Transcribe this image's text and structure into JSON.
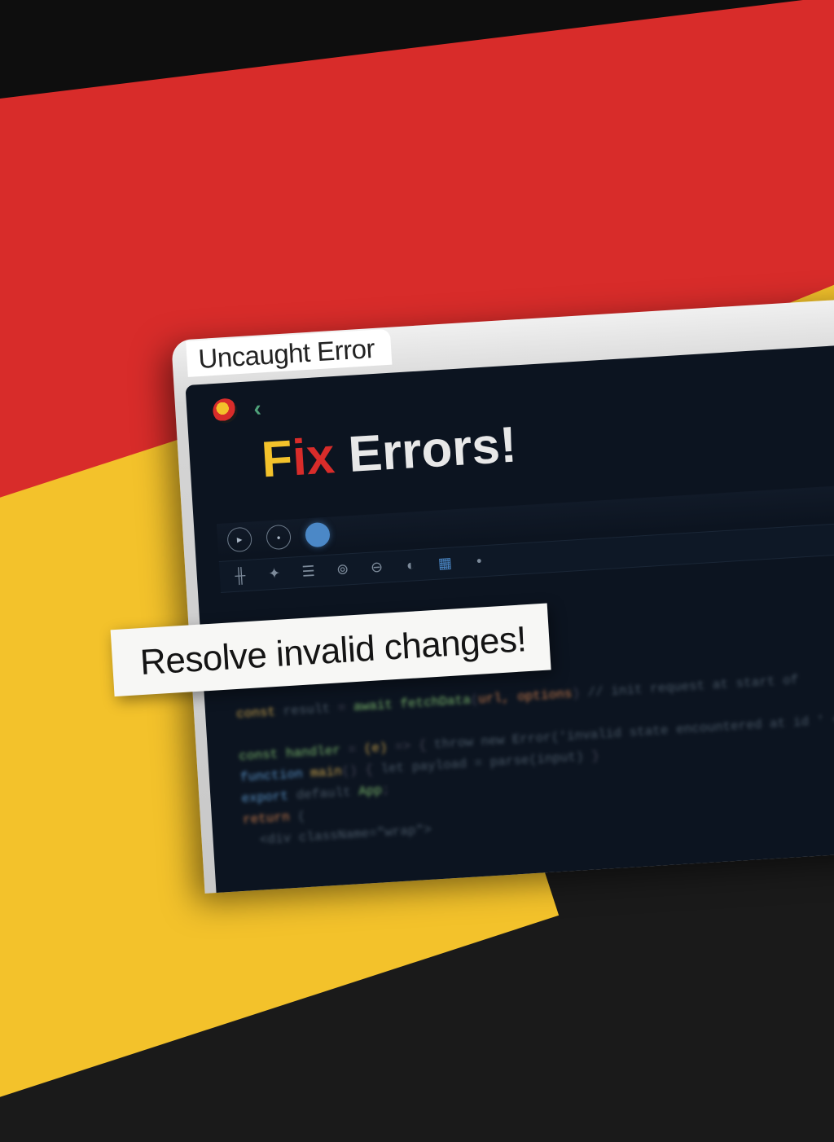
{
  "tab": {
    "title": "Uncaught Error"
  },
  "headline": {
    "part_f": "F",
    "part_ix": "ix",
    "suffix": " Errors!"
  },
  "banner": {
    "text": "Resolve invalid changes!"
  },
  "icons": {
    "logo": "app-logo",
    "back": "‹"
  }
}
